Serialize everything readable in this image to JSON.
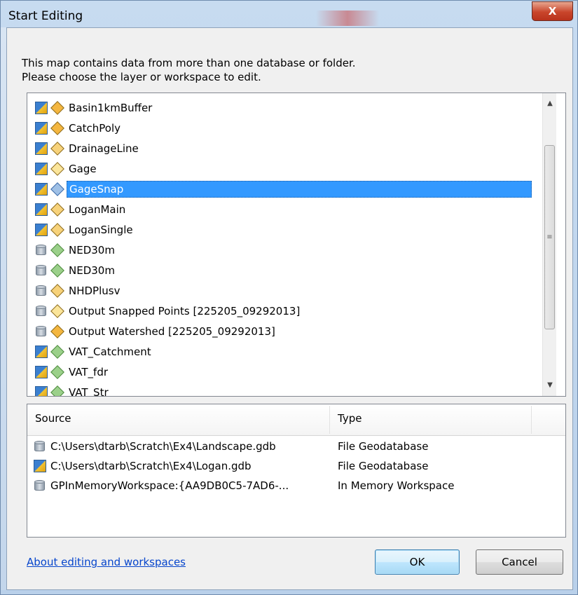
{
  "window": {
    "title": "Start Editing",
    "close_label": "X"
  },
  "intro": {
    "line1": "This map contains data from more than one database or folder.",
    "line2": "Please choose the layer or workspace to edit."
  },
  "layers": [
    {
      "label": "Basin1kmBuffer",
      "workspace_icon": "edit-workspace-icon",
      "type_icon": "polygon-feature-icon"
    },
    {
      "label": "CatchPoly",
      "workspace_icon": "edit-workspace-icon",
      "type_icon": "polygon-feature-icon"
    },
    {
      "label": "DrainageLine",
      "workspace_icon": "edit-workspace-icon",
      "type_icon": "line-feature-icon"
    },
    {
      "label": "Gage",
      "workspace_icon": "edit-workspace-icon",
      "type_icon": "point-feature-icon"
    },
    {
      "label": "GageSnap",
      "workspace_icon": "edit-workspace-icon",
      "type_icon": "point-feature-icon",
      "selected": true
    },
    {
      "label": "LoganMain",
      "workspace_icon": "edit-workspace-icon",
      "type_icon": "line-feature-icon"
    },
    {
      "label": "LoganSingle",
      "workspace_icon": "edit-workspace-icon",
      "type_icon": "line-feature-icon"
    },
    {
      "label": "NED30m",
      "workspace_icon": "database-icon",
      "type_icon": "raster-icon"
    },
    {
      "label": "NED30m",
      "workspace_icon": "database-icon",
      "type_icon": "raster-icon"
    },
    {
      "label": "NHDPlusv",
      "workspace_icon": "database-icon",
      "type_icon": "line-feature-icon"
    },
    {
      "label": "Output Snapped Points [225205_09292013]",
      "workspace_icon": "database-icon",
      "type_icon": "point-feature-icon"
    },
    {
      "label": "Output Watershed [225205_09292013]",
      "workspace_icon": "database-icon",
      "type_icon": "polygon-feature-icon"
    },
    {
      "label": "VAT_Catchment",
      "workspace_icon": "edit-workspace-icon",
      "type_icon": "raster-icon"
    },
    {
      "label": "VAT_fdr",
      "workspace_icon": "edit-workspace-icon",
      "type_icon": "raster-icon"
    },
    {
      "label": "VAT_Str",
      "workspace_icon": "edit-workspace-icon",
      "type_icon": "raster-icon"
    }
  ],
  "workspace_table": {
    "columns": [
      "Source",
      "Type"
    ],
    "rows": [
      {
        "source": "C:\\Users\\dtarb\\Scratch\\Ex4\\Landscape.gdb",
        "type": "File Geodatabase",
        "icon": "database-icon"
      },
      {
        "source": "C:\\Users\\dtarb\\Scratch\\Ex4\\Logan.gdb",
        "type": "File Geodatabase",
        "icon": "edit-workspace-icon"
      },
      {
        "source": "GPInMemoryWorkspace:{AA9DB0C5-7AD6-...",
        "type": "In Memory Workspace",
        "icon": "database-icon"
      }
    ]
  },
  "footer": {
    "help_link": "About editing and workspaces",
    "ok_label": "OK",
    "cancel_label": "Cancel"
  },
  "colors": {
    "selection": "#3399ff",
    "link": "#0645cc",
    "close_button": "#c9452b"
  }
}
